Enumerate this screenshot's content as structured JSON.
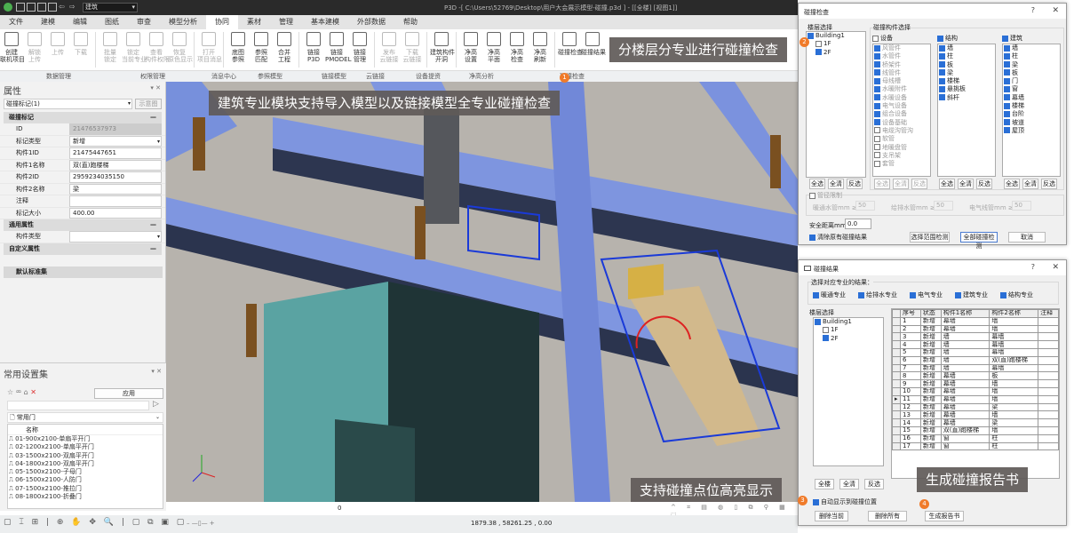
{
  "titlebar": {
    "discipline": "建筑",
    "title": "P3D -[ C:\\Users\\52769\\Desktop\\用户大会展示模型-碰撞.p3d ] - [[全楼] [视图1]]"
  },
  "menu": [
    "文件",
    "建模",
    "编辑",
    "图纸",
    "审查",
    "模型分析",
    "协同",
    "素材",
    "管理",
    "基本建模",
    "外部数据",
    "帮助"
  ],
  "menu_active": 6,
  "ribbon": [
    {
      "label": "创建\n联机项目",
      "dis": false
    },
    {
      "label": "解锁\n上传",
      "dis": true
    },
    {
      "label": "上传",
      "dis": true
    },
    {
      "label": "下载",
      "dis": true
    },
    {
      "sep": true
    },
    {
      "label": "批量\n锁定",
      "dis": true
    },
    {
      "label": "锁定\n当前专业",
      "dis": true
    },
    {
      "label": "查看\n构件权限",
      "dis": true
    },
    {
      "label": "恢复\n原色显示",
      "dis": true
    },
    {
      "sep": true
    },
    {
      "label": "打开\n项目消息",
      "dis": true
    },
    {
      "sep": true
    },
    {
      "label": "底图\n参照",
      "dis": false
    },
    {
      "label": "参照\n匹配",
      "dis": false
    },
    {
      "label": "合并\n工程",
      "dis": false
    },
    {
      "sep": true
    },
    {
      "label": "链接\nP3D",
      "dis": false
    },
    {
      "label": "链接\nPMODEL",
      "dis": false
    },
    {
      "label": "链接\n管理",
      "dis": false
    },
    {
      "sep": true
    },
    {
      "label": "发布\n云链接",
      "dis": true
    },
    {
      "label": "下载\n云链接",
      "dis": true
    },
    {
      "sep": true
    },
    {
      "label": "建筑构件\n开洞",
      "dis": false
    },
    {
      "sep": true
    },
    {
      "label": "净高\n设置",
      "dis": false
    },
    {
      "label": "净高\n平面",
      "dis": false
    },
    {
      "label": "净高\n检查",
      "dis": false
    },
    {
      "label": "净高\n刷新",
      "dis": false
    },
    {
      "sep": true
    },
    {
      "label": "碰撞检查",
      "dis": false
    },
    {
      "label": "碰撞结果",
      "dis": false
    }
  ],
  "groups": [
    "数据管理",
    "权限管理",
    "消息中心",
    "参照模型",
    "链接模型",
    "云链接",
    "设备提资",
    "净高分析",
    "碰撞检查"
  ],
  "properties": {
    "title": "属性",
    "selector": "碰撞标记(1)",
    "preview_btn": "示意图",
    "sections": [
      {
        "name": "碰撞标记",
        "rows": [
          [
            "ID",
            "2147653797​3"
          ],
          [
            "标记类型",
            "新增"
          ],
          [
            "构件1ID",
            "2147544765​1"
          ],
          [
            "构件1名称",
            "双(直)跑楼梯"
          ],
          [
            "构件2ID",
            "2959234035​150"
          ],
          [
            "构件2名称",
            "梁"
          ],
          [
            "注释",
            ""
          ],
          [
            "标记大小",
            "400.00"
          ]
        ]
      },
      {
        "name": "通用属性",
        "rows": [
          [
            "构件类型",
            ""
          ]
        ]
      },
      {
        "name": "自定义属性",
        "rows": []
      }
    ],
    "default_set": "默认标准集"
  },
  "settings": {
    "title": "常用设置集",
    "apply": "应用",
    "category": "常用门",
    "col": "名称",
    "items": [
      "01-900x2100-单扇平开门",
      "02-1200x2100-单扇平开门",
      "03-1500x2100-双扇平开门",
      "04-1800x2100-双扇平开门",
      "05-1500x2100-子母门",
      "06-1500x2100-人防门",
      "07-1500x2100-推拉门",
      "08-1800x2100-折叠门"
    ]
  },
  "callouts": {
    "c1": "分楼层分专业进行碰撞检查",
    "c2": "建筑专业模块支持导入模型以及链接模型全专业碰撞检查",
    "c3": "支持碰撞点位高亮显示",
    "c4": "生成碰撞报告书"
  },
  "badges": [
    "1",
    "2",
    "3",
    "4"
  ],
  "viewtool": {
    "value": "0"
  },
  "status": {
    "coords": "1879.38 , 58261.25 , 0.00"
  },
  "dlg1": {
    "title": "碰撞检查",
    "floor_label": "楼层选择",
    "building": "Building1",
    "floors": [
      {
        "n": "1F",
        "on": false
      },
      {
        "n": "2F",
        "on": true
      }
    ],
    "comp_label": "碰撞构件选择",
    "cols": [
      {
        "name": "设备",
        "on": false,
        "items": [
          [
            "风管件",
            1
          ],
          [
            "水管件",
            1
          ],
          [
            "桥架件",
            1
          ],
          [
            "线管件",
            1
          ],
          [
            "母线槽",
            1
          ],
          [
            "水暖附件",
            1
          ],
          [
            "水暖设备",
            1
          ],
          [
            "电气设备",
            1
          ],
          [
            "组合设备",
            1
          ],
          [
            "设备基础",
            1
          ],
          [
            "电缆沟管沟",
            0
          ],
          [
            "软管",
            0
          ],
          [
            "地暖盘管",
            0
          ],
          [
            "支吊架",
            0
          ],
          [
            "套管",
            0
          ]
        ],
        "dis": true
      },
      {
        "name": "结构",
        "on": true,
        "items": [
          [
            "墙",
            1
          ],
          [
            "柱",
            1
          ],
          [
            "板",
            1
          ],
          [
            "梁",
            1
          ],
          [
            "楼梯",
            1
          ],
          [
            "悬挑板",
            1
          ],
          [
            "斜杆",
            1
          ]
        ]
      },
      {
        "name": "建筑",
        "on": true,
        "items": [
          [
            "墙",
            1
          ],
          [
            "柱",
            1
          ],
          [
            "梁",
            1
          ],
          [
            "板",
            1
          ],
          [
            "门",
            1
          ],
          [
            "窗",
            1
          ],
          [
            "幕墙",
            1
          ],
          [
            "楼梯",
            1
          ],
          [
            "台阶",
            1
          ],
          [
            "坡道",
            1
          ],
          [
            "屋顶",
            1
          ]
        ]
      }
    ],
    "btn_all": "全选",
    "btn_clear": "全清",
    "btn_invert": "反选",
    "pipe_label": "管径限制",
    "pipes": [
      [
        "暖通水管mm ≥",
        "50"
      ],
      [
        "给排水管mm ≥",
        "50"
      ],
      [
        "电气线管mm ≥",
        "50"
      ]
    ],
    "safe_label": "安全距离mm",
    "safe_value": "0.0",
    "clear_label": "清除原有碰撞结果",
    "btn_range": "选择范围检测",
    "btn_all_check": "全部碰撞检测",
    "btn_cancel": "取消"
  },
  "dlg2": {
    "title": "碰撞结果",
    "disc_label": "选择对应专业的结果：",
    "disciplines": [
      "暖通专业",
      "给排水专业",
      "电气专业",
      "建筑专业",
      "结构专业"
    ],
    "floor_label": "楼层选择",
    "building": "Building1",
    "floors": [
      {
        "n": "1F",
        "on": false
      },
      {
        "n": "2F",
        "on": true
      }
    ],
    "headers": [
      "序号",
      "状态",
      "构件1名称",
      "构件2名称",
      "注释"
    ],
    "rows": [
      [
        "1",
        "新增",
        "幕墙",
        "墙"
      ],
      [
        "2",
        "新增",
        "幕墙",
        "墙"
      ],
      [
        "3",
        "新增",
        "墙",
        "幕墙"
      ],
      [
        "4",
        "新增",
        "墙",
        "幕墙"
      ],
      [
        "5",
        "新增",
        "墙",
        "幕墙"
      ],
      [
        "6",
        "新增",
        "墙",
        "双(直)跑楼梯"
      ],
      [
        "7",
        "新增",
        "墙",
        "幕墙"
      ],
      [
        "8",
        "新增",
        "幕墙",
        "板"
      ],
      [
        "9",
        "新增",
        "幕墙",
        "墙"
      ],
      [
        "10",
        "新增",
        "幕墙",
        "墙"
      ],
      [
        "11",
        "新增",
        "幕墙",
        "墙"
      ],
      [
        "12",
        "新增",
        "幕墙",
        "梁"
      ],
      [
        "13",
        "新增",
        "幕墙",
        "墙"
      ],
      [
        "14",
        "新增",
        "幕墙",
        "梁"
      ],
      [
        "15",
        "新增",
        "双(直)跑楼梯",
        "墙"
      ],
      [
        "16",
        "新增",
        "窗",
        "柱"
      ],
      [
        "17",
        "新增",
        "窗",
        "柱"
      ]
    ],
    "current_row": 11,
    "btn_all": "全楼",
    "btn_clear": "全清",
    "btn_invert": "反选",
    "auto_label": "自动显示到碰撞位置",
    "btn_del_cur": "删除当前",
    "btn_del_all": "删除所有",
    "btn_report": "生成报告书"
  }
}
